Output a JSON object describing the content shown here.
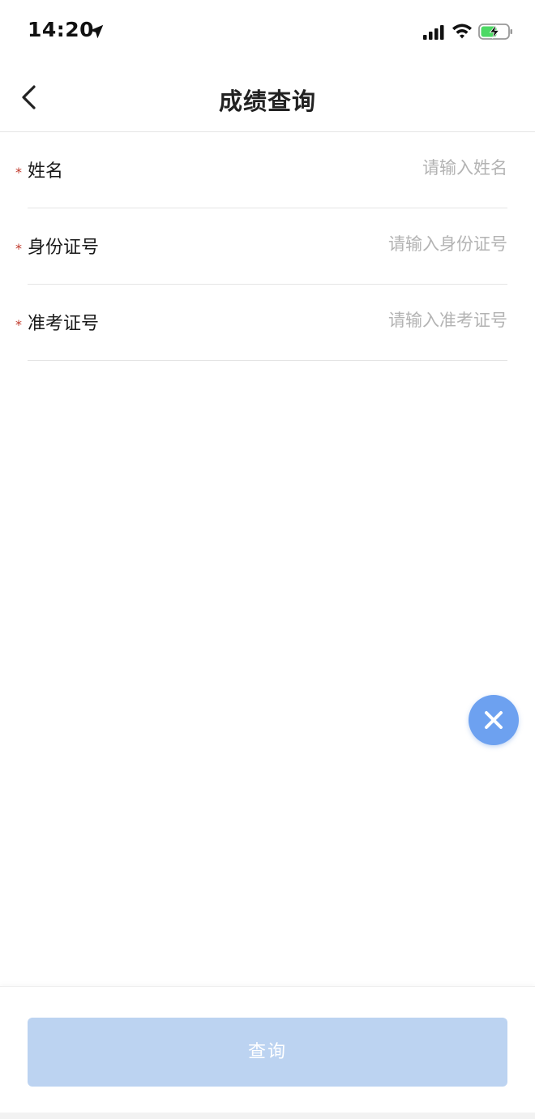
{
  "status_bar": {
    "time": "14:20",
    "icons": [
      "location-arrow-icon",
      "cellular-signal-icon",
      "wifi-icon",
      "battery-charging-icon"
    ]
  },
  "nav": {
    "title": "成绩查询",
    "back_icon": "chevron-left-icon"
  },
  "form": {
    "required_mark": "*",
    "fields": [
      {
        "label": "姓名",
        "placeholder": "请输入姓名",
        "value": ""
      },
      {
        "label": "身份证号",
        "placeholder": "请输入身份证号",
        "value": ""
      },
      {
        "label": "准考证号",
        "placeholder": "请输入准考证号",
        "value": ""
      }
    ]
  },
  "float_button": {
    "icon": "close-icon",
    "color": "#6da1f0"
  },
  "footer": {
    "query_label": "查询",
    "button_color": "#bcd3f1"
  },
  "colors": {
    "accent": "#6da1f0",
    "required": "#c0392b",
    "placeholder": "#b3b3b3"
  }
}
